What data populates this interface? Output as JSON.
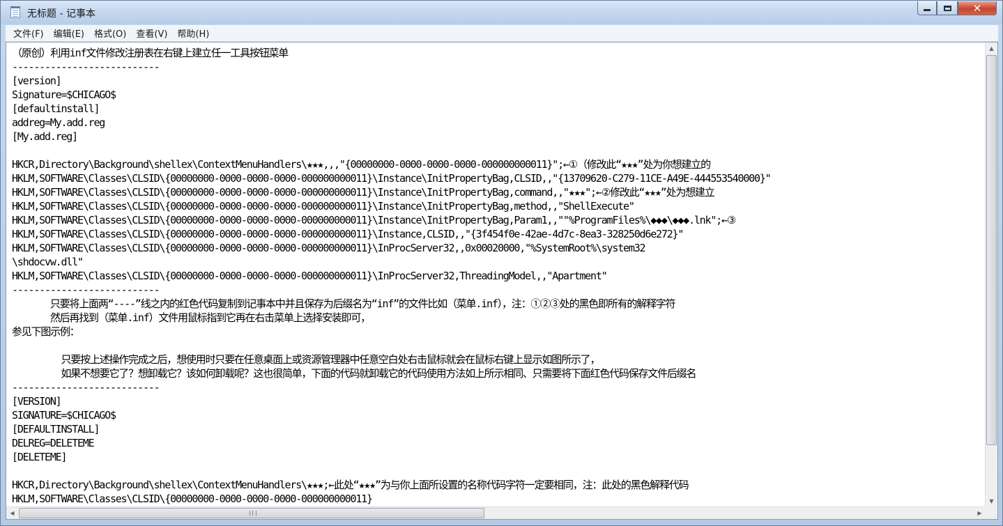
{
  "window": {
    "title": "无标题 - 记事本"
  },
  "controls": {
    "minimize_icon": "minimize-icon",
    "maximize_icon": "maximize-icon",
    "close_icon": "close-icon",
    "close_glyph": "✕"
  },
  "menu": {
    "items": [
      "文件(F)",
      "编辑(E)",
      "格式(O)",
      "查看(V)",
      "帮助(H)"
    ]
  },
  "editor": {
    "lines": [
      "（原创）利用inf文件修改注册表在右键上建立任一工具按钮菜单",
      "---------------------------",
      "[version]",
      "Signature=$CHICAGO$",
      "[defaultinstall]",
      "addreg=My.add.reg",
      "[My.add.reg]",
      "",
      "HKCR,Directory\\Background\\shellex\\ContextMenuHandlers\\★★★,,,\"{00000000-0000-0000-0000-000000000011}\";←①（修改此“★★★”处为你想建立的",
      "HKLM,SOFTWARE\\Classes\\CLSID\\{00000000-0000-0000-0000-000000000011}\\Instance\\InitPropertyBag,CLSID,,\"{13709620-C279-11CE-A49E-444553540000}\"",
      "HKLM,SOFTWARE\\Classes\\CLSID\\{00000000-0000-0000-0000-000000000011}\\Instance\\InitPropertyBag,command,,\"★★★\";←②修改此“★★★”处为想建立",
      "HKLM,SOFTWARE\\Classes\\CLSID\\{00000000-0000-0000-0000-000000000011}\\Instance\\InitPropertyBag,method,,\"ShellExecute\"",
      "HKLM,SOFTWARE\\Classes\\CLSID\\{00000000-0000-0000-0000-000000000011}\\Instance\\InitPropertyBag,Param1,,\"\"%ProgramFiles%\\◆◆◆\\◆◆◆.lnk\";←③",
      "HKLM,SOFTWARE\\Classes\\CLSID\\{00000000-0000-0000-0000-000000000011}\\Instance,CLSID,,\"{3f454f0e-42ae-4d7c-8ea3-328250d6e272}\"",
      "HKLM,SOFTWARE\\Classes\\CLSID\\{00000000-0000-0000-0000-000000000011}\\InProcServer32,,0x00020000,\"%SystemRoot%\\system32",
      "\\shdocvw.dll\"",
      "HKLM,SOFTWARE\\Classes\\CLSID\\{00000000-0000-0000-0000-000000000011}\\InProcServer32,ThreadingModel,,\"Apartment\"",
      "---------------------------",
      "       只要将上面两“----”线之内的红色代码复制到记事本中并且保存为后缀名为“inf”的文件比如（菜单.inf），注：①②③处的黑色即所有的解释字符",
      "       然后再找到（菜单.inf）文件用鼠标指到它再在右击菜单上选择安装即可，",
      "参见下图示例：",
      "",
      "         只要按上述操作完成之后，想使用时只要在任意桌面上或资源管理器中任意空白处右击鼠标就会在鼠标右键上显示如图所示了，",
      "         如果不想要它了？想卸载它？该如何卸载呢？这也很简单，下面的代码就卸载它的代码使用方法如上所示相同、只需要将下面红色代码保存文件后缀名",
      "---------------------------",
      "[VERSION]",
      "SIGNATURE=$CHICAGO$",
      "[DEFAULTINSTALL]",
      "DELREG=DELETEME",
      "[DELETEME]",
      "",
      "HKCR,Directory\\Background\\shellex\\ContextMenuHandlers\\★★★;←此处“★★★”为与你上面所设置的名称代码字符一定要相同，注：此处的黑色解释代码",
      "HKLM,SOFTWARE\\Classes\\CLSID\\{00000000-0000-0000-0000-000000000011}"
    ]
  },
  "scrollbars": {
    "up_arrow": "▲",
    "down_arrow": "▼",
    "left_arrow": "◀",
    "right_arrow": "▶"
  }
}
